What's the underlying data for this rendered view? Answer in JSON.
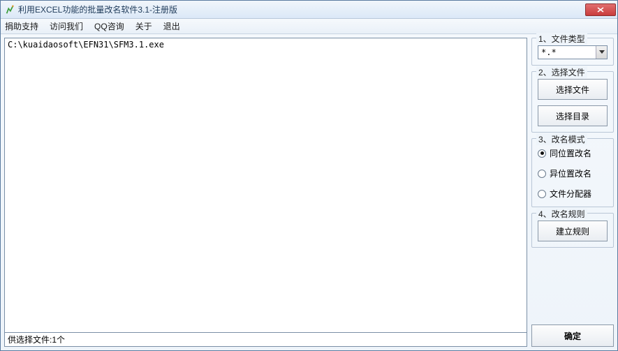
{
  "window": {
    "title": "利用EXCEL功能的批量改名软件3.1-注册版"
  },
  "menu": {
    "items": [
      "捐助支持",
      "访问我们",
      "QQ咨询",
      "关于",
      "退出"
    ]
  },
  "file_list": {
    "rows": [
      "C:\\kuaidaosoft\\EFN31\\SFM3.1.exe"
    ],
    "status": "供选择文件:1个"
  },
  "panel": {
    "file_type": {
      "title": "1、文件类型",
      "selected": "*.*"
    },
    "select_files": {
      "title": "2、选择文件",
      "select_file_btn": "选择文件",
      "select_dir_btn": "选择目录"
    },
    "rename_mode": {
      "title": "3、改名模式",
      "options": [
        {
          "label": "同位置改名",
          "checked": true
        },
        {
          "label": "异位置改名",
          "checked": false
        },
        {
          "label": "文件分配器",
          "checked": false
        }
      ]
    },
    "rename_rule": {
      "title": "4、改名规则",
      "build_rule_btn": "建立规则"
    },
    "confirm_btn": "确定"
  }
}
